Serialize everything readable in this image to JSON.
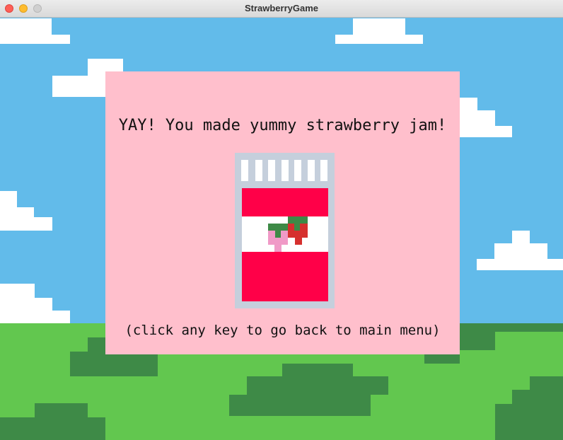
{
  "window": {
    "title": "StrawberryGame"
  },
  "dialog": {
    "message": "YAY! You made yummy strawberry jam!",
    "hint": "(click any key to go back to main menu)"
  },
  "icons": [
    "close-icon",
    "minimize-icon",
    "zoom-icon",
    "jam-jar-icon",
    "strawberry-icon"
  ],
  "colors": {
    "sky": "#62bbea",
    "cloud": "#ffffff",
    "grass": "#62c74f",
    "grass_dark": "#3e8a47",
    "panel": "#ffbfcc",
    "jar_frame": "#c5cfdc",
    "jam": "#ff0048",
    "strawberry": "#d6302e",
    "leaf": "#3e8a47",
    "pink_berry": "#f09ac7"
  }
}
